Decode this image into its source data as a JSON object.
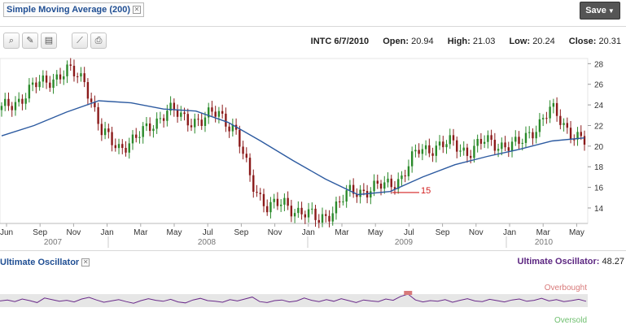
{
  "header": {
    "indicator_label": "Simple Moving Average (200)",
    "save_label": "Save"
  },
  "toolbar": {
    "icons": [
      "zoom-icon",
      "draw-icon",
      "notes-icon",
      "compare-icon",
      "print-icon"
    ]
  },
  "quote": {
    "symbol_date": "INTC 6/7/2010",
    "open_label": "Open:",
    "open": "20.94",
    "high_label": "High:",
    "high": "21.03",
    "low_label": "Low:",
    "low": "20.24",
    "close_label": "Close:",
    "close": "20.31"
  },
  "price_chart": {
    "y_ticks": [
      "28",
      "26",
      "24",
      "22",
      "20",
      "18",
      "16",
      "14"
    ],
    "month_labels": [
      "Jun",
      "Sep",
      "Nov",
      "Jan",
      "Mar",
      "May",
      "Jul",
      "Sep",
      "Nov",
      "Jan",
      "Mar",
      "May",
      "Jul",
      "Sep",
      "Nov",
      "Jan",
      "Mar",
      "May"
    ],
    "year_labels": [
      "2007",
      "2008",
      "2009",
      "2010"
    ],
    "annotation_text": "15",
    "colors": {
      "up": "#2a8a2a",
      "down": "#8b1a1a",
      "sma": "#2c5aa0",
      "annotation": "#d32020"
    }
  },
  "oscillator": {
    "label": "Ultimate Oscillator",
    "value_label": "Ultimate Oscillator:",
    "value": "48.27",
    "overbought": "Overbought",
    "oversold": "Oversold",
    "colors": {
      "line": "#6a2a8a",
      "band": "#e6e6e6",
      "overbought": "#d87a7a"
    }
  },
  "chart_data": [
    {
      "type": "line",
      "title": "",
      "series": [
        {
          "name": "INTC",
          "x": [
            "Jun 2007",
            "Jul 2007",
            "Sep 2007",
            "Oct 2007",
            "Nov 2007",
            "Dec 2007",
            "Jan 2008",
            "Feb 2008",
            "Mar 2008",
            "Apr 2008",
            "May 2008",
            "Jun 2008",
            "Jul 2008",
            "Aug 2008",
            "Sep 2008",
            "Oct 2008",
            "Nov 2008",
            "Dec 2008",
            "Jan 2009",
            "Feb 2009",
            "Mar 2009",
            "Apr 2009",
            "May 2009",
            "Jun 2009",
            "Jul 2009",
            "Aug 2009",
            "Sep 2009",
            "Oct 2009",
            "Nov 2009",
            "Dec 2009",
            "Jan 2010",
            "Feb 2010",
            "Mar 2010",
            "Apr 2010",
            "May 2010",
            "Jun 2010"
          ],
          "values": [
            23.5,
            24.5,
            25.8,
            26.6,
            27.2,
            26.5,
            21.2,
            20.0,
            20.5,
            22.2,
            23.4,
            22.8,
            22.3,
            23.5,
            21.5,
            16.6,
            14.0,
            14.4,
            13.6,
            12.8,
            14.0,
            15.6,
            15.8,
            16.1,
            17.0,
            19.5,
            20.0,
            20.2,
            19.5,
            20.4,
            20.2,
            20.0,
            21.8,
            23.5,
            21.7,
            20.31
          ]
        },
        {
          "name": "Simple Moving Average (200)",
          "x": [
            "Jun 2007",
            "Sep 2007",
            "Nov 2007",
            "Jan 2008",
            "Mar 2008",
            "May 2008",
            "Jul 2008",
            "Sep 2008",
            "Nov 2008",
            "Jan 2009",
            "Mar 2009",
            "May 2009",
            "Jul 2009",
            "Sep 2009",
            "Nov 2009",
            "Jan 2010",
            "Mar 2010",
            "May 2010",
            "Jun 2010"
          ],
          "values": [
            21.0,
            22.0,
            23.3,
            24.4,
            24.2,
            23.6,
            23.4,
            22.3,
            20.5,
            18.6,
            16.8,
            15.3,
            15.6,
            17.0,
            18.2,
            19.0,
            19.7,
            20.5,
            20.8
          ]
        }
      ],
      "ylim": [
        12.5,
        28.5
      ],
      "annotation": {
        "text": "15",
        "x": "Jul 2009",
        "y": 15.5
      }
    },
    {
      "type": "line",
      "title": "",
      "series": [
        {
          "name": "Ultimate Oscillator",
          "values": [
            49,
            52,
            47,
            55,
            50,
            44,
            58,
            53,
            48,
            51,
            46,
            55,
            60,
            52,
            45,
            49,
            53,
            47,
            42,
            50,
            56,
            51,
            48,
            54,
            46,
            43,
            52,
            57,
            50,
            48,
            45,
            53,
            49,
            55,
            61,
            47,
            44,
            50,
            52,
            46,
            49,
            58,
            51,
            47,
            53,
            48,
            56,
            50,
            44,
            52,
            49,
            47,
            55,
            51,
            63,
            70,
            52,
            46,
            50,
            48,
            53,
            45,
            51,
            56,
            49,
            47,
            54,
            50,
            46,
            52,
            55,
            48,
            51,
            57,
            49,
            53,
            47,
            50,
            54,
            48
          ]
        }
      ],
      "ylim": [
        0,
        100
      ],
      "levels": {
        "overbought": 70,
        "oversold": 30
      },
      "latest": 48.27
    }
  ]
}
